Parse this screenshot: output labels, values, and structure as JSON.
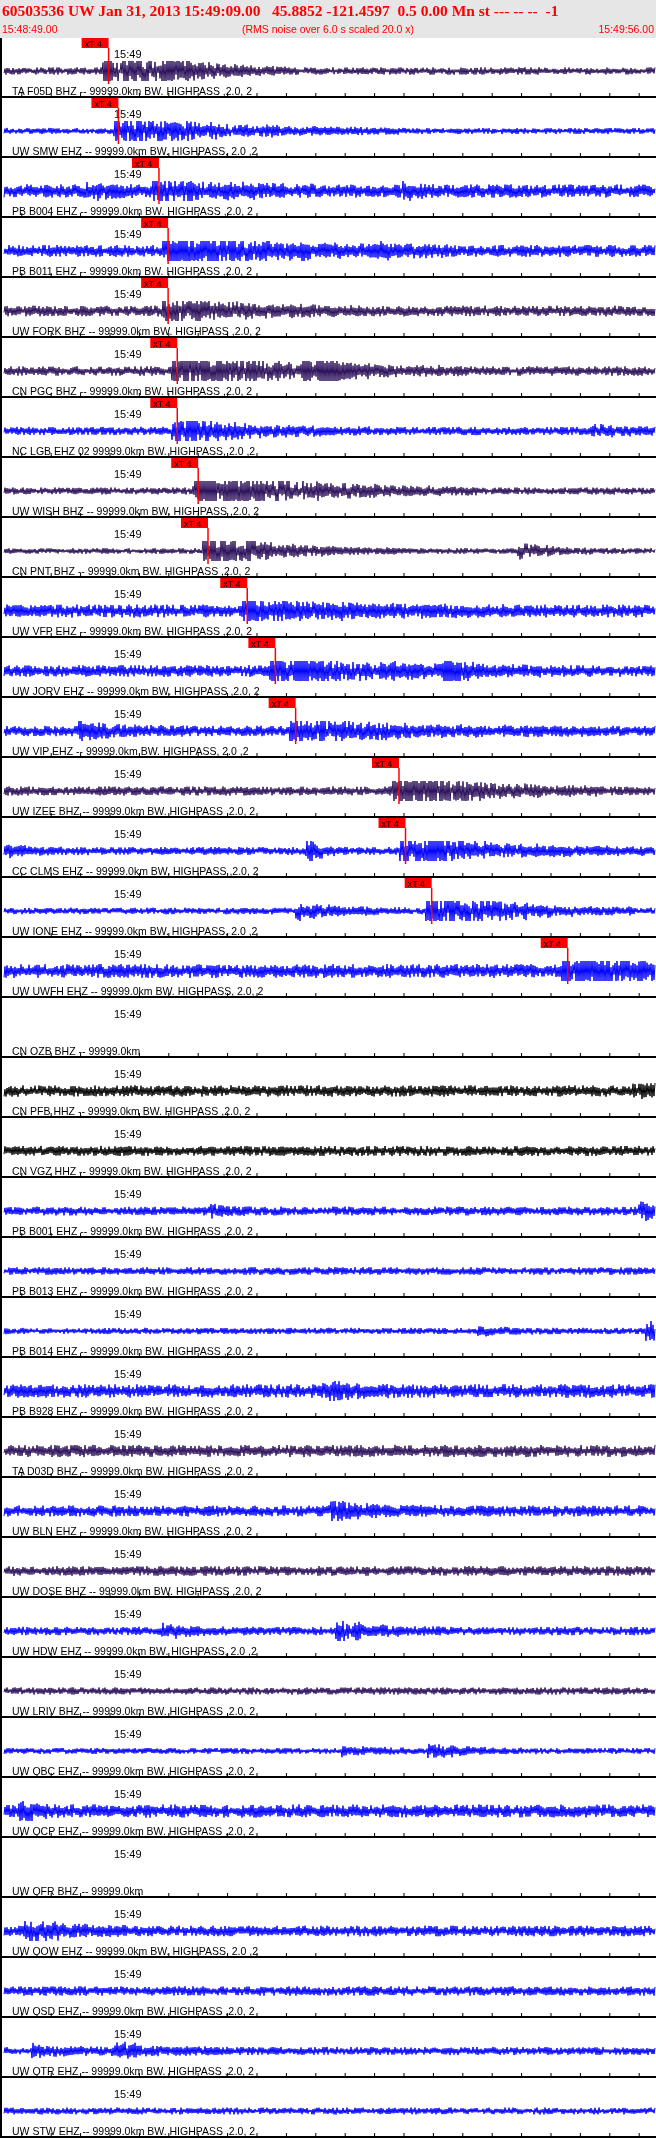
{
  "header": {
    "title": "60503536 UW Jan 31, 2013 15:49:09.00   45.8852 -121.4597  0.5 0.00 Mn st --- -- --  -1",
    "start_time": "15:48:49.00",
    "note": "(RMS noise over 6.0 s scaled 20.0 x)",
    "end_time": "15:49:56.00"
  },
  "traces": [
    {
      "kind": "waveform",
      "color": "#2b0f5a",
      "time": "15:49",
      "label": "TA F05D BHZ -- 99999.0km BW. HIGHPASS ,2.0, 2",
      "pick": {
        "label": "xT 4",
        "level": 0.163
      }
    },
    {
      "kind": "waveform",
      "color": "#0000ff",
      "time": "15:49",
      "label": "UW SMW EHZ -- 99999.0km BW. HIGHPASS, 2.0 ,2",
      "pick": {
        "label": "xT 4",
        "level": 0.178
      }
    },
    {
      "kind": "waveform",
      "color": "#0000ff",
      "time": "15:49",
      "label": "PB B004 EHZ -- 99999.0km BW. HIGHPASS ,2.0, 2",
      "pick": {
        "label": "xT 4",
        "level": 0.24
      }
    },
    {
      "kind": "waveform",
      "color": "#0000ff",
      "time": "15:49",
      "label": "PB B011 EHZ -- 99999.0km BW. HIGHPASS ,2.0, 2",
      "pick": {
        "label": "xT 4",
        "level": 0.254
      }
    },
    {
      "kind": "waveform",
      "color": "#2b0f5a",
      "time": "15:49",
      "label": "UW FORK BHZ -- 99999.0km BW. HIGHPASS ,2.0, 2",
      "pick": {
        "label": "xT 4",
        "level": 0.254
      }
    },
    {
      "kind": "waveform",
      "color": "#2b0f5a",
      "time": "15:49",
      "label": "CN PGC BHZ -- 99999.0km BW. HIGHPASS ,2.0, 2",
      "pick": {
        "label": "xT 4",
        "level": 0.268
      }
    },
    {
      "kind": "waveform",
      "color": "#0000ff",
      "time": "15:49",
      "label": "NC LGB EHZ 02 99999.0km BW. HIGHPASS, 2.0 ,2",
      "pick": {
        "label": "xT 4",
        "level": 0.268
      }
    },
    {
      "kind": "waveform",
      "color": "#2b0f5a",
      "time": "15:49",
      "label": "UW WISH BHZ -- 99999.0km BW. HIGHPASS ,2.0, 2",
      "pick": {
        "label": "xT 4",
        "level": 0.3
      }
    },
    {
      "kind": "waveform",
      "color": "#2b0f5a",
      "time": "15:49",
      "label": "CN PNT BHZ -- 99999.0km BW. HIGHPASS ,2.0, 2",
      "pick": {
        "label": "xT 4",
        "level": 0.315
      }
    },
    {
      "kind": "waveform",
      "color": "#0000ff",
      "time": "15:49",
      "label": "UW VFP EHZ -- 99999.0km BW. HIGHPASS ,2.0, 2",
      "pick": {
        "label": "xT 4",
        "level": 0.375
      }
    },
    {
      "kind": "waveform",
      "color": "#0000ff",
      "time": "15:49",
      "label": "UW JORV EHZ -- 99999.0km BW. HIGHPASS ,2.0, 2",
      "pick": {
        "label": "xT 4",
        "level": 0.418
      }
    },
    {
      "kind": "waveform",
      "color": "#0000ff",
      "time": "15:49",
      "label": "UW VIP EHZ -- 99999.0km BW. HIGHPASS, 2.0 ,2",
      "pick": {
        "label": "xT 4",
        "level": 0.449
      }
    },
    {
      "kind": "waveform",
      "color": "#2b0f5a",
      "time": "15:49",
      "label": "UW IZEE BHZ -- 99999.0km BW. HIGHPASS ,2.0, 2",
      "pick": {
        "label": "xT 4",
        "level": 0.607
      }
    },
    {
      "kind": "waveform",
      "color": "#0000ff",
      "time": "15:49",
      "label": "CC CLMS EHZ -- 99999.0km BW. HIGHPASS ,2.0, 2",
      "pick": {
        "label": "xT 4",
        "level": 0.617
      }
    },
    {
      "kind": "waveform",
      "color": "#0000ff",
      "time": "15:49",
      "label": "UW IONE EHZ -- 99999.0km BW. HIGHPASS, 2.0 ,2",
      "pick": {
        "label": "xT 4",
        "level": 0.657
      }
    },
    {
      "kind": "waveform",
      "color": "#0000ff",
      "time": "15:49",
      "label": "UW UWFH EHZ -- 99999.0km BW. HIGHPASS, 2.0, 2",
      "pick": {
        "label": "xT 4",
        "level": 0.865
      }
    },
    {
      "kind": "empty",
      "time": "15:49",
      "label": "CN OZB BHZ -- 99999.0km"
    },
    {
      "kind": "waveform",
      "color": "#000000",
      "time": "15:49",
      "label": "CN PFB HHZ -- 99999.0km BW. HIGHPASS ,2.0, 2"
    },
    {
      "kind": "waveform",
      "color": "#000000",
      "time": "15:49",
      "label": "CN VGZ HHZ -- 99999.0km BW. HIGHPASS ,2.0, 2"
    },
    {
      "kind": "waveform",
      "color": "#0000ff",
      "time": "15:49",
      "label": "PB B001 EHZ -- 99999.0km BW. HIGHPASS ,2.0, 2"
    },
    {
      "kind": "waveform",
      "color": "#0000ff",
      "time": "15:49",
      "label": "PB B013 EHZ -- 99999.0km BW. HIGHPASS ,2.0, 2"
    },
    {
      "kind": "waveform",
      "color": "#0000ff",
      "time": "15:49",
      "label": "PB B014 EHZ -- 99999.0km BW. HIGHPASS ,2.0, 2"
    },
    {
      "kind": "waveform",
      "color": "#0000ff",
      "time": "15:49",
      "label": "PB B928 EHZ -- 99999.0km BW. HIGHPASS ,2.0, 2"
    },
    {
      "kind": "waveform",
      "color": "#2b0f5a",
      "time": "15:49",
      "label": "TA D03D BHZ -- 99999.0km BW. HIGHPASS ,2.0, 2"
    },
    {
      "kind": "waveform",
      "color": "#0000ff",
      "time": "15:49",
      "label": "UW BLN EHZ -- 99999.0km BW. HIGHPASS ,2.0, 2"
    },
    {
      "kind": "waveform",
      "color": "#2b0f5a",
      "time": "15:49",
      "label": "UW DOSE BHZ -- 99999.0km BW. HIGHPASS ,2.0, 2"
    },
    {
      "kind": "waveform",
      "color": "#0000ff",
      "time": "15:49",
      "label": "UW HDW EHZ -- 99999.0km BW. HIGHPASS, 2.0 ,2"
    },
    {
      "kind": "waveform",
      "color": "#2b0f5a",
      "time": "15:49",
      "label": "UW LRIV BHZ -- 99999.0km BW. HIGHPASS ,2.0, 2"
    },
    {
      "kind": "waveform",
      "color": "#0000ff",
      "time": "15:49",
      "label": "UW QBC EHZ -- 99999.0km BW. HIGHPASS ,2.0, 2"
    },
    {
      "kind": "waveform",
      "color": "#0000ff",
      "time": "15:49",
      "label": "UW QCP EHZ -- 99999.0km BW. HIGHPASS ,2.0, 2"
    },
    {
      "kind": "empty",
      "time": "15:49",
      "label": "UW QFR BHZ -- 99999.0km"
    },
    {
      "kind": "waveform",
      "color": "#0000ff",
      "time": "15:49",
      "label": "UW QOW EHZ -- 99999.0km BW. HIGHPASS, 2.0 ,2"
    },
    {
      "kind": "waveform",
      "color": "#0000ff",
      "time": "15:49",
      "label": "UW QSD EHZ -- 99999.0km BW. HIGHPASS ,2.0, 2"
    },
    {
      "kind": "waveform",
      "color": "#0000ff",
      "time": "15:49",
      "label": "UW QTR EHZ -- 99999.0km BW. HIGHPASS ,2.0, 2"
    },
    {
      "kind": "waveform",
      "color": "#0000ff",
      "time": "15:49",
      "label": "UW STW EHZ -- 99999.0km BW. HIGHPASS ,2.0, 2"
    }
  ]
}
